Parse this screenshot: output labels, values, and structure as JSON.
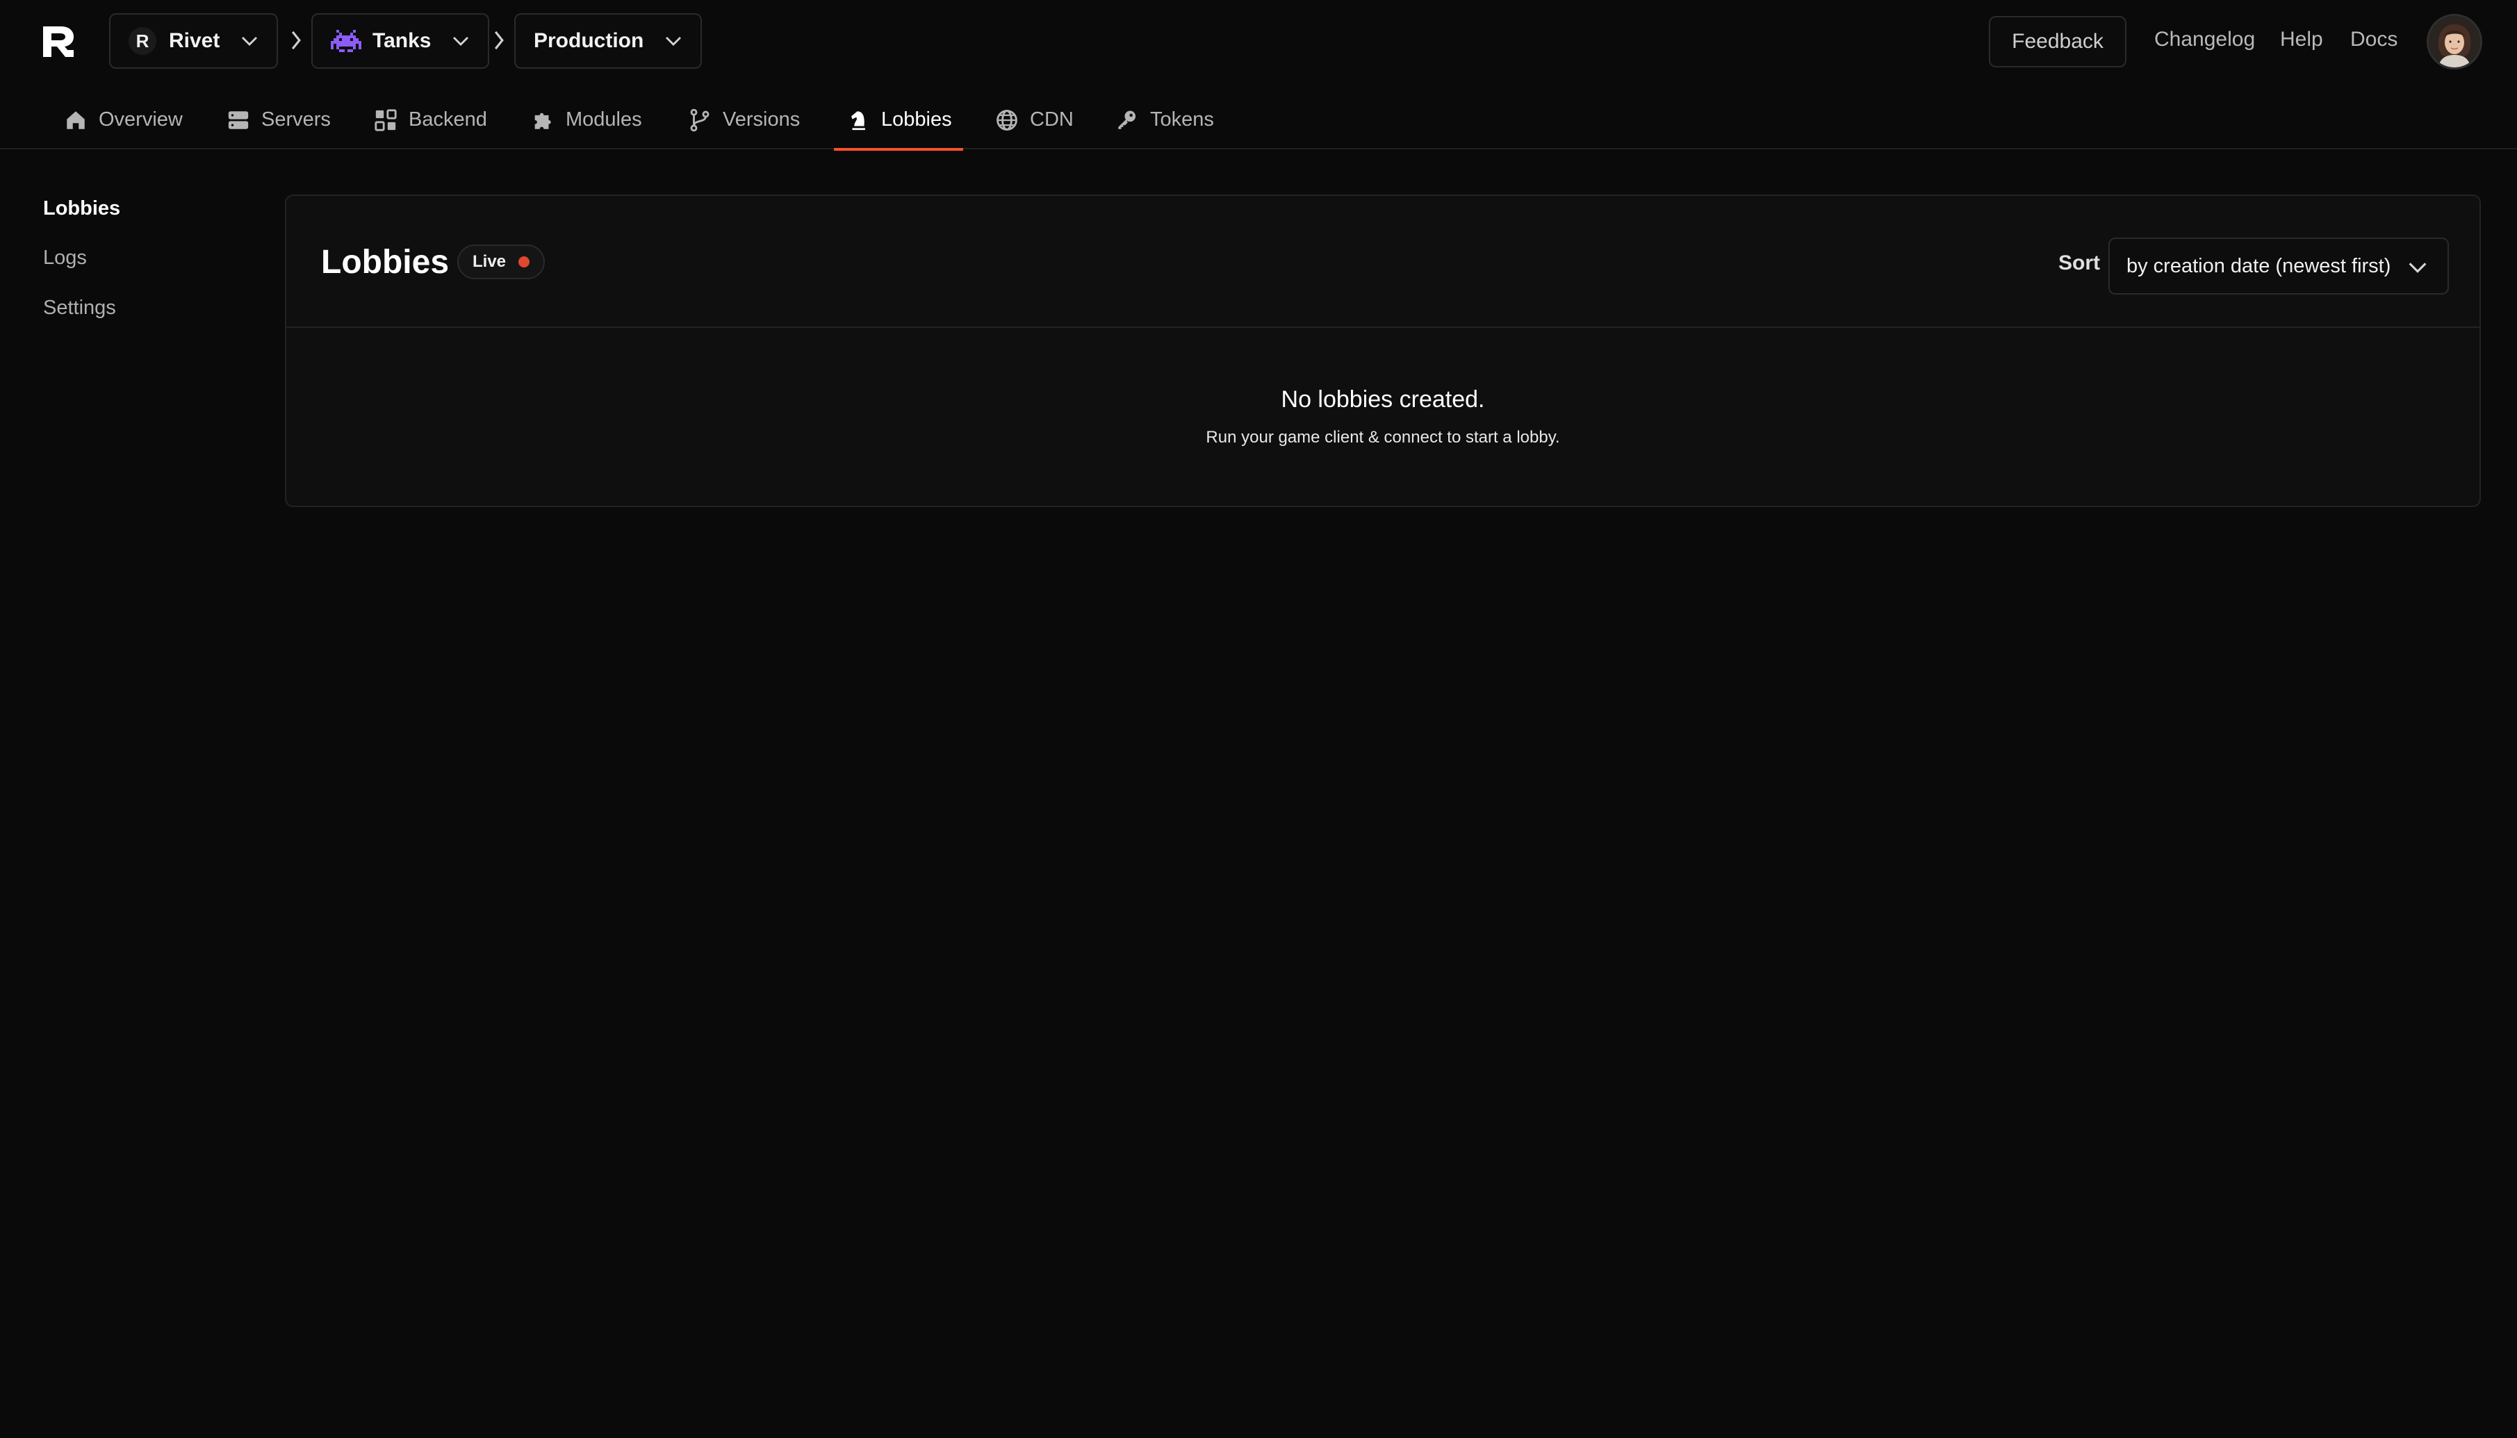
{
  "header": {
    "breadcrumbs": [
      {
        "label": "Rivet",
        "badge": "R"
      },
      {
        "label": "Tanks",
        "icon": "space-invader-icon"
      },
      {
        "label": "Production"
      }
    ],
    "feedback_label": "Feedback",
    "links": [
      "Changelog",
      "Help",
      "Docs"
    ]
  },
  "tabs": [
    {
      "label": "Overview",
      "icon": "home-icon"
    },
    {
      "label": "Servers",
      "icon": "server-icon"
    },
    {
      "label": "Backend",
      "icon": "backend-icon"
    },
    {
      "label": "Modules",
      "icon": "puzzle-icon"
    },
    {
      "label": "Versions",
      "icon": "branch-icon"
    },
    {
      "label": "Lobbies",
      "icon": "chess-knight-icon",
      "active": true
    },
    {
      "label": "CDN",
      "icon": "globe-icon"
    },
    {
      "label": "Tokens",
      "icon": "key-icon"
    }
  ],
  "sidebar": {
    "items": [
      {
        "label": "Lobbies",
        "active": true
      },
      {
        "label": "Logs"
      },
      {
        "label": "Settings"
      }
    ]
  },
  "main": {
    "title": "Lobbies",
    "live_badge": "Live",
    "live_color": "#e0472f",
    "sort_label": "Sort",
    "sort_value": "by creation date (newest first)",
    "empty_title": "No lobbies created.",
    "empty_subtitle": "Run your game client & connect to start a lobby."
  },
  "colors": {
    "accent": "#ff4f2e",
    "game_icon": "#8b5cf6"
  }
}
